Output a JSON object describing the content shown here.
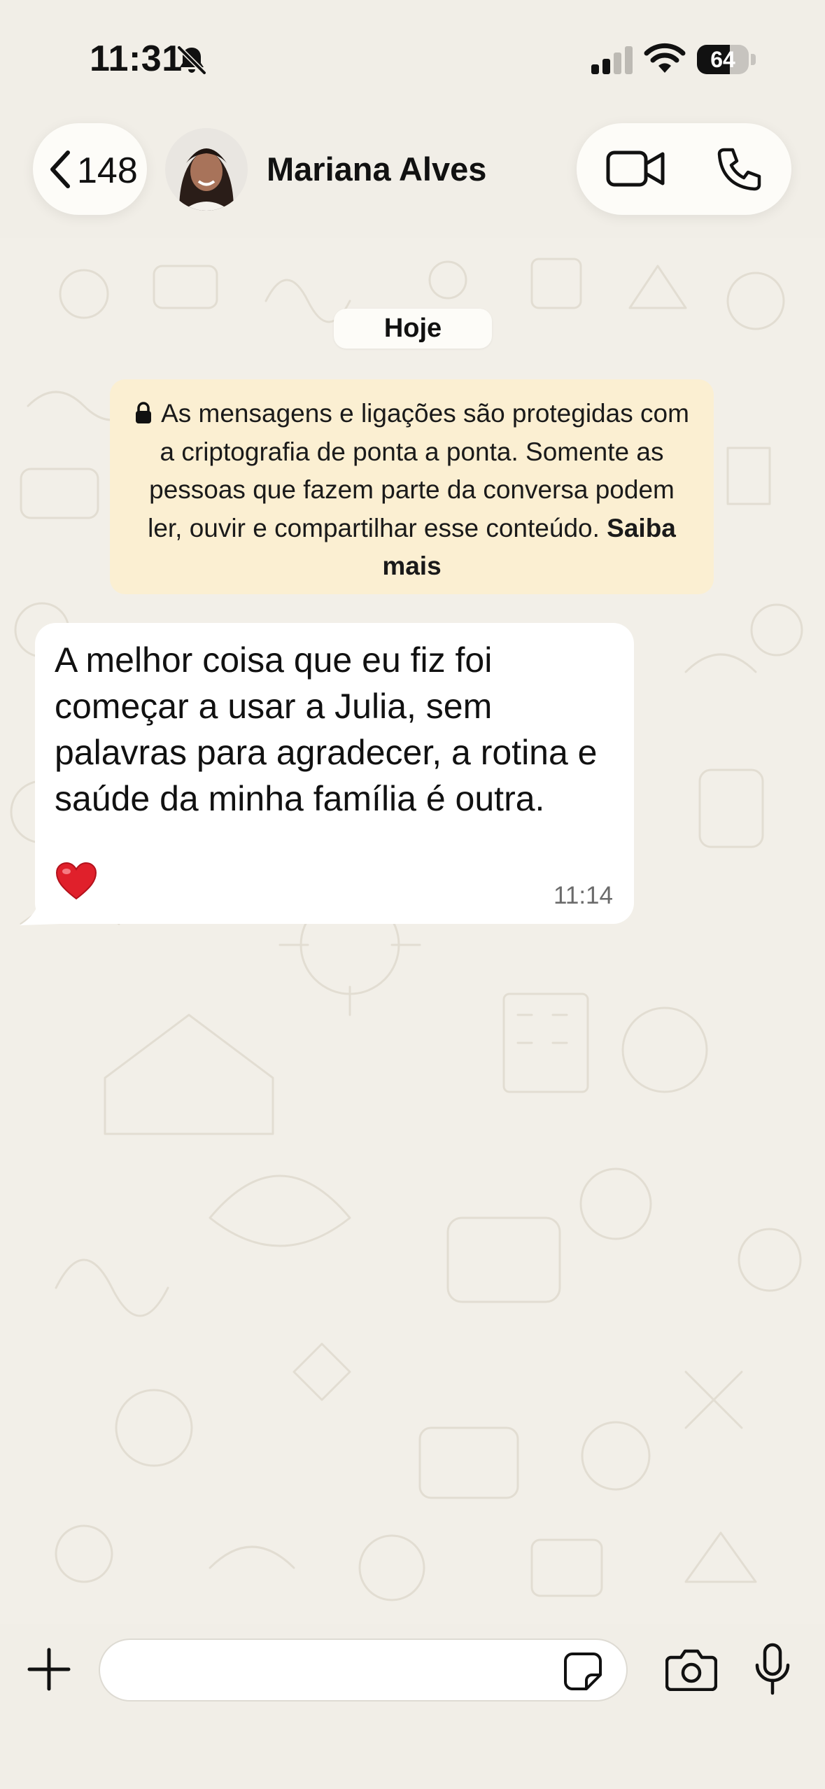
{
  "status_bar": {
    "time": "11:31",
    "bell_icon": "bell-slash-icon",
    "signal_icon": "cellular-signal-icon",
    "wifi_icon": "wifi-icon",
    "battery_level": "64",
    "battery_fraction": 0.64
  },
  "header": {
    "back_icon": "chevron-left-icon",
    "unread_count": "148",
    "contact_name": "Mariana Alves",
    "video_icon": "video-camera-icon",
    "phone_icon": "phone-icon"
  },
  "chat": {
    "date_label": "Hoje",
    "encryption_notice": {
      "icon": "lock-icon",
      "text": "As mensagens e ligações são protegidas com a criptografia de ponta a ponta. Somente as pessoas que fazem parte da conversa podem ler, ouvir e compartilhar esse conteúdo.",
      "link": "Saiba mais"
    },
    "messages": [
      {
        "direction": "incoming",
        "text": "A melhor coisa que eu fiz foi começar a usar a Julia, sem palavras para agradecer, a rotina e saúde da minha família é outra.",
        "reaction_icon": "red-heart-icon",
        "time": "11:14"
      }
    ]
  },
  "input_bar": {
    "plus_icon": "plus-icon",
    "message_value": "",
    "sticker_icon": "sticker-icon",
    "camera_icon": "camera-icon",
    "mic_icon": "microphone-icon"
  },
  "colors": {
    "background": "#f1eee7",
    "notice_bg": "#fbefd2",
    "bubble_bg": "#ffffff",
    "heart": "#e0202b"
  }
}
